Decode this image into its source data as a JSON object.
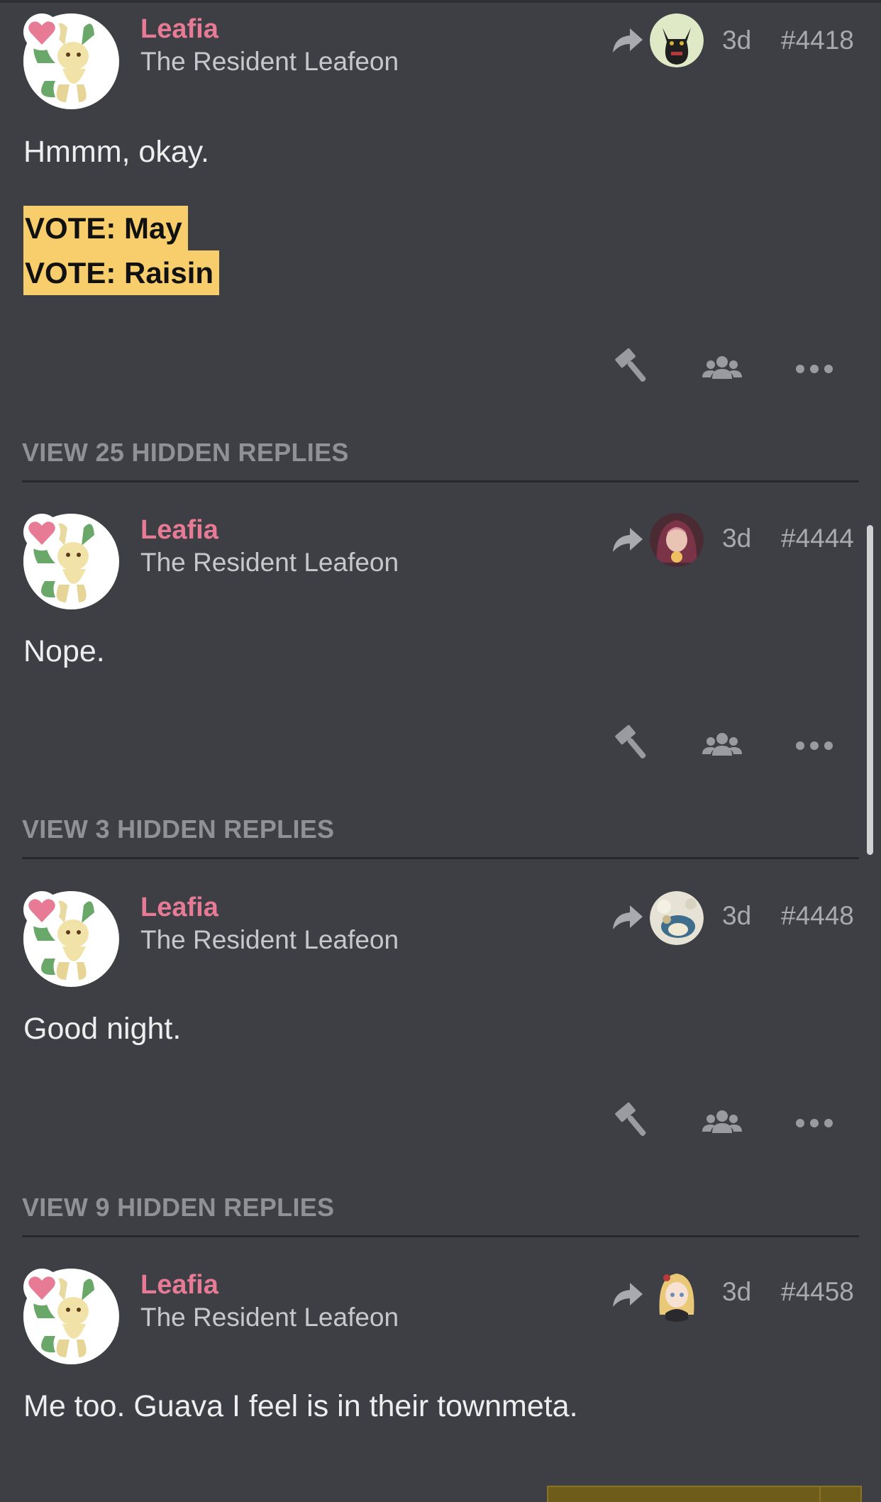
{
  "posts": [
    {
      "username": "Leafia",
      "user_title": "The Resident Leafeon",
      "age": "3d",
      "post_number": "#4418",
      "body": "Hmmm, okay.",
      "votes": [
        "VOTE: May",
        "VOTE: Raisin"
      ],
      "reply_to_avatar": "black-cat-avatar"
    },
    {
      "username": "Leafia",
      "user_title": "The Resident Leafeon",
      "age": "3d",
      "post_number": "#4444",
      "body": "Nope.",
      "reply_to_avatar": "hooded-girl-avatar"
    },
    {
      "username": "Leafia",
      "user_title": "The Resident Leafeon",
      "age": "3d",
      "post_number": "#4448",
      "body": "Good night.",
      "reply_to_avatar": "sleeping-creature-avatar"
    },
    {
      "username": "Leafia",
      "user_title": "The Resident Leafeon",
      "age": "3d",
      "post_number": "#4458",
      "body": "Me too. Guava I feel is in their townmeta.",
      "reply_to_avatar": "blonde-girl-avatar"
    }
  ],
  "hidden_replies": [
    "VIEW 25 HIDDEN REPLIES",
    "VIEW 3 HIDDEN REPLIES",
    "VIEW 9 HIDDEN REPLIES"
  ],
  "icons": {
    "reply": "reply-arrow-icon",
    "vote": "gavel-icon",
    "group": "users-icon",
    "more": "ellipsis-icon",
    "badge": "heart-icon"
  },
  "colors": {
    "background": "#3d3f44",
    "username": "#e77a94",
    "vote_highlight": "#f7ce6b",
    "muted": "#8f9196"
  }
}
